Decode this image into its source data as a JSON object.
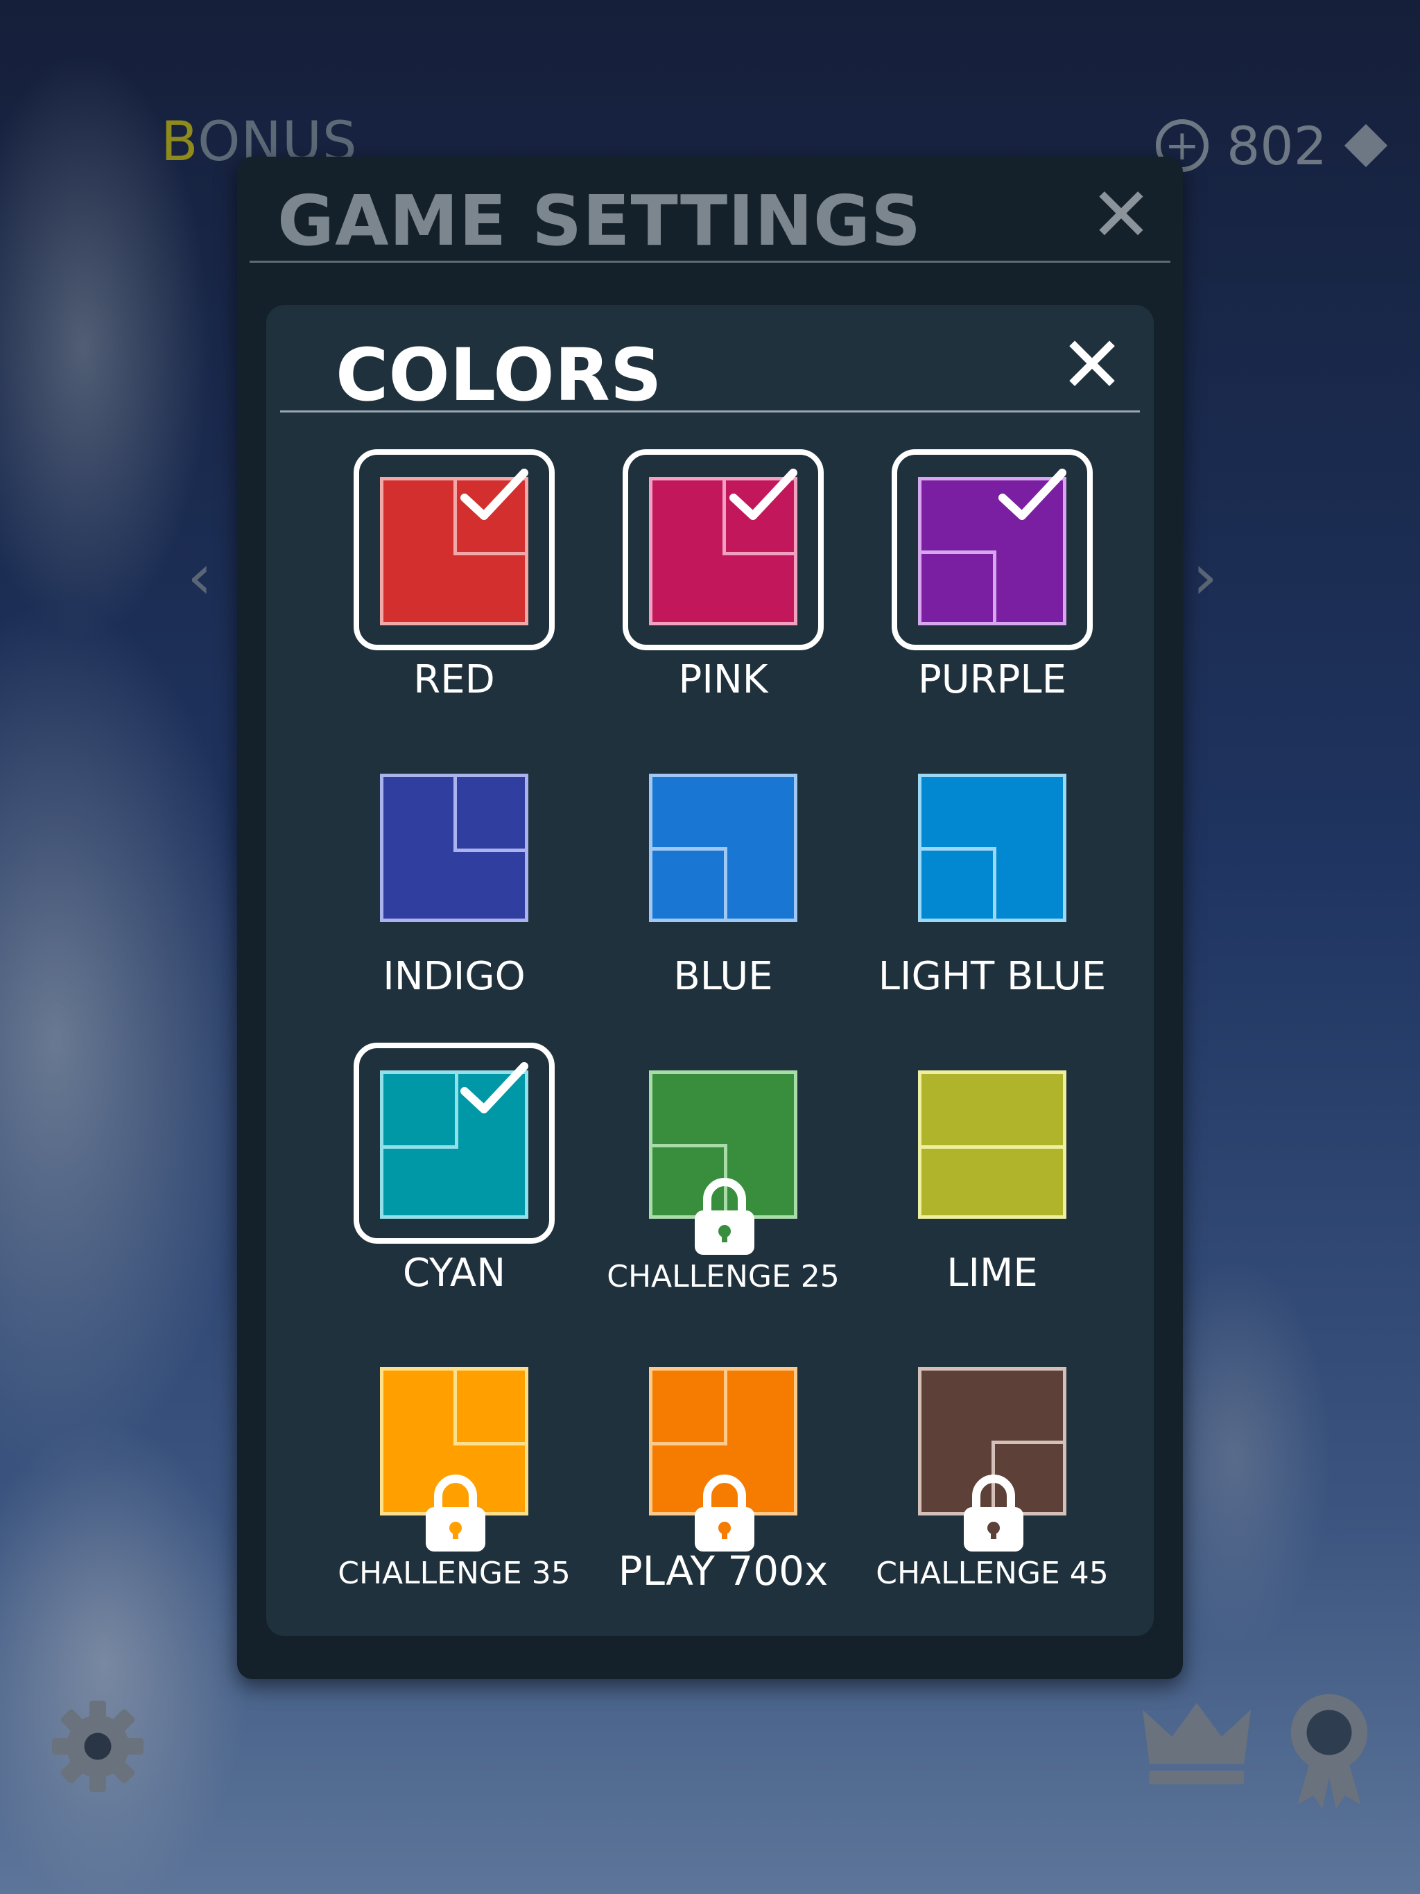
{
  "background": {
    "bonus_label": "BONUS",
    "coin_count": "802"
  },
  "dialog": {
    "title": "GAME SETTINGS",
    "close_glyph": "✕"
  },
  "colors_panel": {
    "title": "COLORS",
    "close_glyph": "✕",
    "items": [
      {
        "label": "RED",
        "color": "#d32f2f",
        "border": "#f2a8a8",
        "selected": true,
        "locked": false,
        "pattern": "tr"
      },
      {
        "label": "PINK",
        "color": "#c2185b",
        "border": "#f2a0c0",
        "selected": true,
        "locked": false,
        "pattern": "tr"
      },
      {
        "label": "PURPLE",
        "color": "#7b1fa2",
        "border": "#d6a6ee",
        "selected": true,
        "locked": false,
        "pattern": "bl"
      },
      {
        "label": "INDIGO",
        "color": "#303f9f",
        "border": "#aab3ee",
        "selected": false,
        "locked": false,
        "pattern": "tr"
      },
      {
        "label": "BLUE",
        "color": "#1976d2",
        "border": "#a0c8f4",
        "selected": false,
        "locked": false,
        "pattern": "bl"
      },
      {
        "label": "LIGHT BLUE",
        "color": "#0288d1",
        "border": "#9bd8f6",
        "selected": false,
        "locked": false,
        "pattern": "bl"
      },
      {
        "label": "CYAN",
        "color": "#0097a7",
        "border": "#93e0ea",
        "selected": true,
        "locked": false,
        "pattern": "tl"
      },
      {
        "label": "CHALLENGE 25",
        "color": "#388e3c",
        "border": "#a8dca8",
        "selected": false,
        "locked": true,
        "pattern": "bl"
      },
      {
        "label": "LIME",
        "color": "#afb42b",
        "border": "#eef0a0",
        "selected": false,
        "locked": false,
        "pattern": "h"
      },
      {
        "label": "CHALLENGE 35",
        "color": "#ffa000",
        "border": "#ffe08a",
        "selected": false,
        "locked": true,
        "pattern": "tr"
      },
      {
        "label": "PLAY 700x",
        "color": "#f57c00",
        "border": "#ffc98a",
        "selected": false,
        "locked": true,
        "pattern": "tl"
      },
      {
        "label": "CHALLENGE 45",
        "color": "#5d4037",
        "border": "#d4c0b8",
        "selected": false,
        "locked": true,
        "pattern": "br"
      }
    ]
  }
}
